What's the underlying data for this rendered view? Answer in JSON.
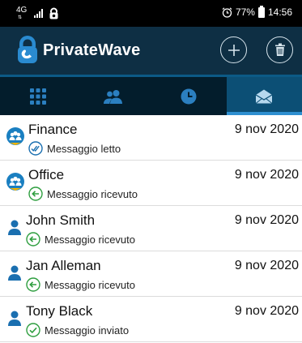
{
  "status_bar": {
    "network_type": "4G",
    "battery_percent": "77%",
    "time": "14:56"
  },
  "app": {
    "title": "PrivateWave"
  },
  "tabs": [
    {
      "icon": "keypad-icon",
      "active": false
    },
    {
      "icon": "contacts-icon",
      "active": false
    },
    {
      "icon": "clock-icon",
      "active": false
    },
    {
      "icon": "envelope-open-icon",
      "active": true
    }
  ],
  "messages": [
    {
      "type": "group",
      "name": "Finance",
      "date": "9 nov 2020",
      "status": "Messaggio letto",
      "status_icon": "double-check-icon"
    },
    {
      "type": "group",
      "name": "Office",
      "date": "9 nov 2020",
      "status": "Messaggio ricevuto",
      "status_icon": "arrow-received-icon"
    },
    {
      "type": "contact",
      "name": "John Smith",
      "date": "9 nov 2020",
      "status": "Messaggio ricevuto",
      "status_icon": "arrow-received-icon"
    },
    {
      "type": "contact",
      "name": "Jan Alleman",
      "date": "9 nov 2020",
      "status": "Messaggio ricevuto",
      "status_icon": "arrow-received-icon"
    },
    {
      "type": "contact",
      "name": "Tony Black",
      "date": "9 nov 2020",
      "status": "Messaggio inviato",
      "status_icon": "check-sent-icon"
    }
  ],
  "colors": {
    "app_bar": "#0e2f44",
    "tab_bar": "#031d2c",
    "tab_active": "#0c4f75",
    "accent_blue": "#1a7fc1",
    "received_green": "#2e9e3f"
  }
}
